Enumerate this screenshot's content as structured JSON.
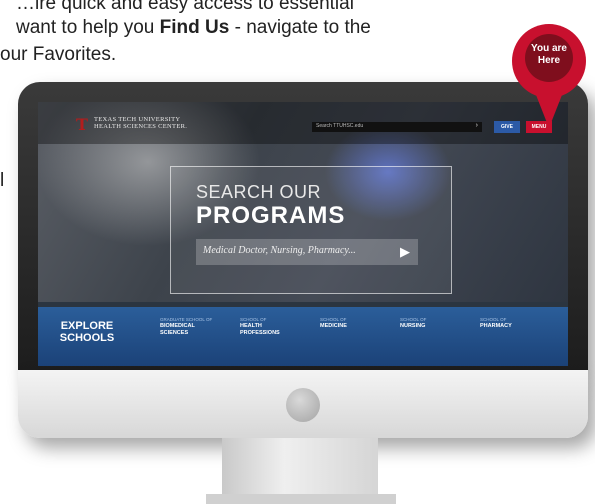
{
  "intro": {
    "line0": "…ire quick and easy access to essential",
    "line1_pre": "want to help you ",
    "line1_bold": "Find Us",
    "line1_post": " - navigate to the",
    "line2": "our Favorites.",
    "side": "l"
  },
  "pin": {
    "line1": "You are",
    "line2": "Here"
  },
  "site": {
    "logo_line1": "TEXAS TECH UNIVERSITY",
    "logo_line2": "HEALTH SCIENCES CENTER.",
    "search_placeholder": "Search TTUHSC.edu",
    "give_label": "GIVE",
    "menu_label": "MENU",
    "hero_line1": "SEARCH OUR",
    "hero_line2": "PROGRAMS",
    "hero_placeholder": "Medical Doctor, Nursing, Pharmacy...",
    "explore_line1": "EXPLORE",
    "explore_line2": "SCHOOLS",
    "schools": [
      {
        "pre": "GRADUATE SCHOOL OF",
        "name1": "BIOMEDICAL",
        "name2": "SCIENCES"
      },
      {
        "pre": "SCHOOL OF",
        "name1": "HEALTH",
        "name2": "PROFESSIONS"
      },
      {
        "pre": "SCHOOL OF",
        "name1": "MEDICINE",
        "name2": ""
      },
      {
        "pre": "SCHOOL OF",
        "name1": "NURSING",
        "name2": ""
      },
      {
        "pre": "SCHOOL OF",
        "name1": "PHARMACY",
        "name2": ""
      }
    ]
  }
}
